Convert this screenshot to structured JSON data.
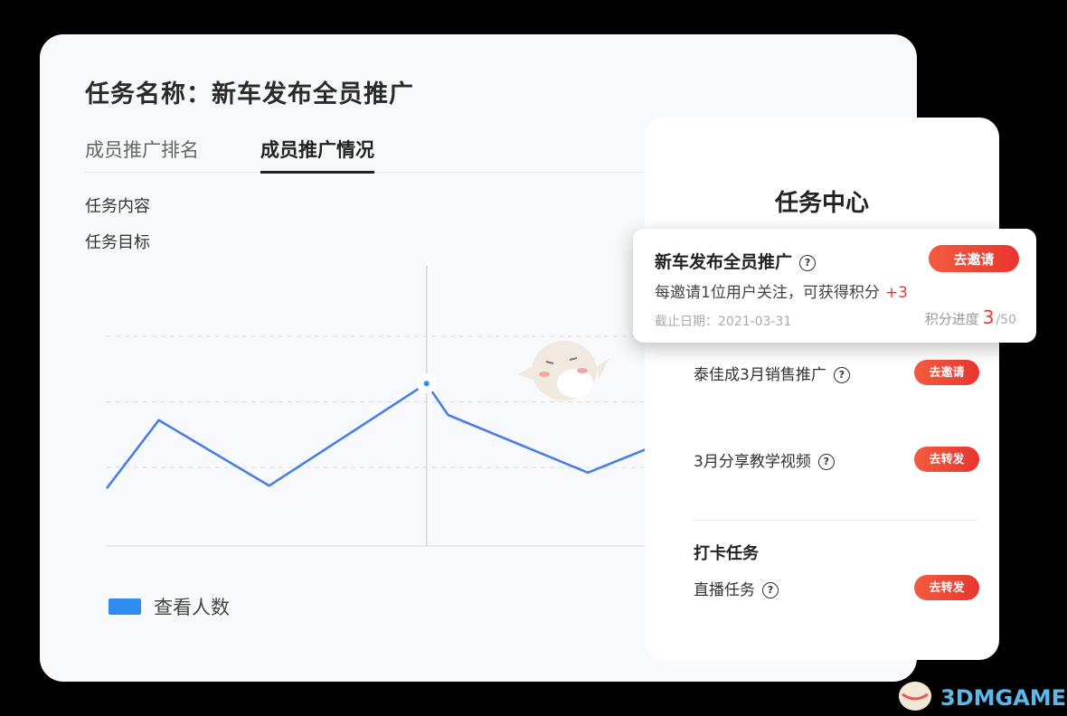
{
  "task": {
    "title": "任务名称：新车发布全员推广",
    "tabs": [
      {
        "label": "成员推广排名",
        "active": false
      },
      {
        "label": "成员推广情况",
        "active": true
      }
    ],
    "info_labels": [
      "任务内容",
      "任务目标"
    ]
  },
  "chart_data": {
    "type": "line",
    "series": [
      {
        "name": "查看人数",
        "values": [
          22,
          48,
          23,
          62,
          50,
          28,
          41
        ]
      }
    ],
    "ylim": [
      0,
      100
    ],
    "grid": true,
    "legend_position": "bottom-left",
    "highlight_index": 3,
    "color": "#4a7ee3"
  },
  "legend": {
    "label": "查看人数"
  },
  "panel": {
    "title": "任务中心",
    "highlight": {
      "name": "新车发布全员推广",
      "button": "去邀请",
      "desc": "每邀请1位用户关注，可获得积分",
      "bonus": "+3",
      "deadline": "截止日期：2021-03-31",
      "progress_label": "积分进度",
      "progress_current": "3",
      "progress_total": "/50"
    },
    "tasks": [
      {
        "name": "泰佳成3月销售推广",
        "button": "去邀请"
      },
      {
        "name": "3月分享教学视频",
        "button": "去转发"
      }
    ],
    "section": {
      "title": "打卡任务",
      "tasks": [
        {
          "name": "直播任务",
          "button": "去转发"
        }
      ]
    }
  },
  "watermark": "3DMGAME",
  "colors": {
    "accent": "#e8352f",
    "line": "#4a7ee3",
    "legend": "#2f8df0"
  }
}
